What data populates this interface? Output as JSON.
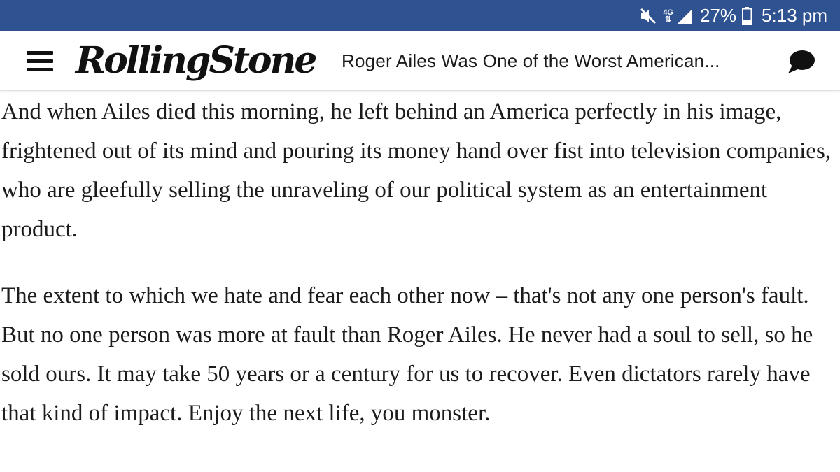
{
  "status_bar": {
    "mute_icon": "mute-icon",
    "network_label": "4G",
    "signal_icon": "signal-icon",
    "battery_percent": "27%",
    "battery_icon": "battery-icon",
    "time": "5:13 pm",
    "background_color": "#2f5291"
  },
  "header": {
    "menu_icon": "hamburger-menu-icon",
    "logo_text": "RollingStone",
    "headline": "Roger Ailes Was One of the Worst American...",
    "comment_icon": "comment-bubble-icon"
  },
  "article": {
    "paragraphs": [
      "And when Ailes died this morning, he left behind an America perfectly in his image, frightened out of its mind and pouring its money hand over fist into television companies, who are gleefully selling the unraveling of our political system as an entertainment product.",
      "The extent to which we hate and fear each other now – that's not any one person's fault. But no one person was more at fault than Roger Ailes. He never had a soul to sell, so he sold ours. It may take 50 years or a century for us to recover. Even dictators rarely have that kind of impact. Enjoy the next life, you monster."
    ]
  }
}
